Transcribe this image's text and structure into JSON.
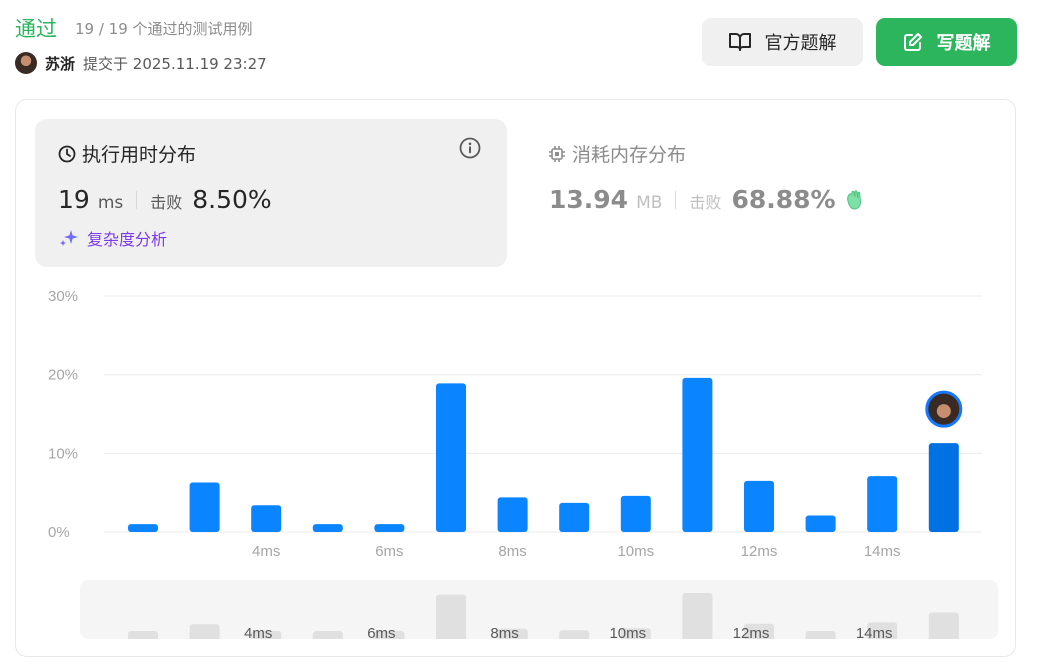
{
  "header": {
    "status": "通过",
    "count": "19 / 19 个通过的测试用例",
    "author": "苏浙",
    "submitted": "提交于 2025.11.19 23:27"
  },
  "buttons": {
    "official_solution": "官方题解",
    "write_solution": "写题解"
  },
  "runtime": {
    "title": "执行用时分布",
    "value": "19",
    "unit": "ms",
    "beat_label": "击败",
    "beat_value": "8.50%",
    "complexity_label": "复杂度分析"
  },
  "memory": {
    "title": "消耗内存分布",
    "value": "13.94",
    "unit": "MB",
    "beat_label": "击败",
    "beat_value": "68.88%"
  },
  "colors": {
    "accent_green": "#2db55d",
    "bar": "#0a84ff",
    "bar_current": "#0071e3",
    "mini_bar": "#e0e0e0"
  },
  "chart_data": {
    "type": "bar",
    "y_tick_labels": [
      "30%",
      "20%",
      "10%",
      "0%"
    ],
    "ylim": [
      0,
      30
    ],
    "x_tick_labels": [
      "4ms",
      "6ms",
      "8ms",
      "10ms",
      "12ms",
      "14ms"
    ],
    "values": [
      1.0,
      6.3,
      3.4,
      1.0,
      1.0,
      18.9,
      4.4,
      3.7,
      4.6,
      19.6,
      6.5,
      2.1,
      7.1,
      11.3
    ],
    "current_index": 13,
    "grid": true
  }
}
